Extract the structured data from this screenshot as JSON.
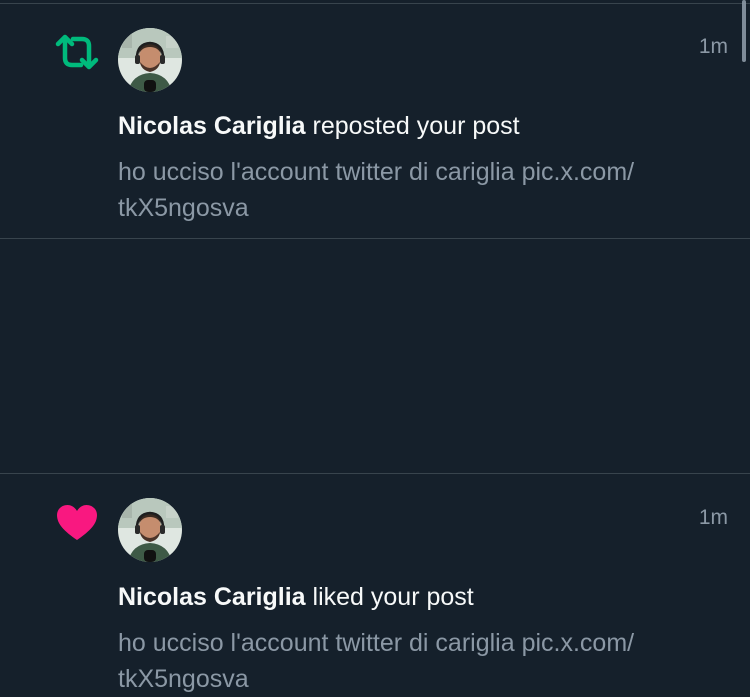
{
  "colors": {
    "background": "#15202b",
    "divider": "#38444d",
    "primary_text": "#f7f9f9",
    "secondary_text": "#8b98a5",
    "repost_green": "#00ba7c",
    "like_pink": "#f91880"
  },
  "notifications": [
    {
      "type_icon": "repost-icon",
      "time": "1m",
      "actor_name": "Nicolas Cariglia",
      "action_text": " reposted your post",
      "post_line1": "ho ucciso l'account twitter di cariglia pic.x.com/",
      "post_line2": "tkX5ngosva"
    },
    {
      "type_icon": "heart-icon",
      "time": "1m",
      "actor_name": "Nicolas Cariglia",
      "action_text": " liked your post",
      "post_line1": "ho ucciso l'account twitter di cariglia pic.x.com/",
      "post_line2": "tkX5ngosva"
    }
  ]
}
